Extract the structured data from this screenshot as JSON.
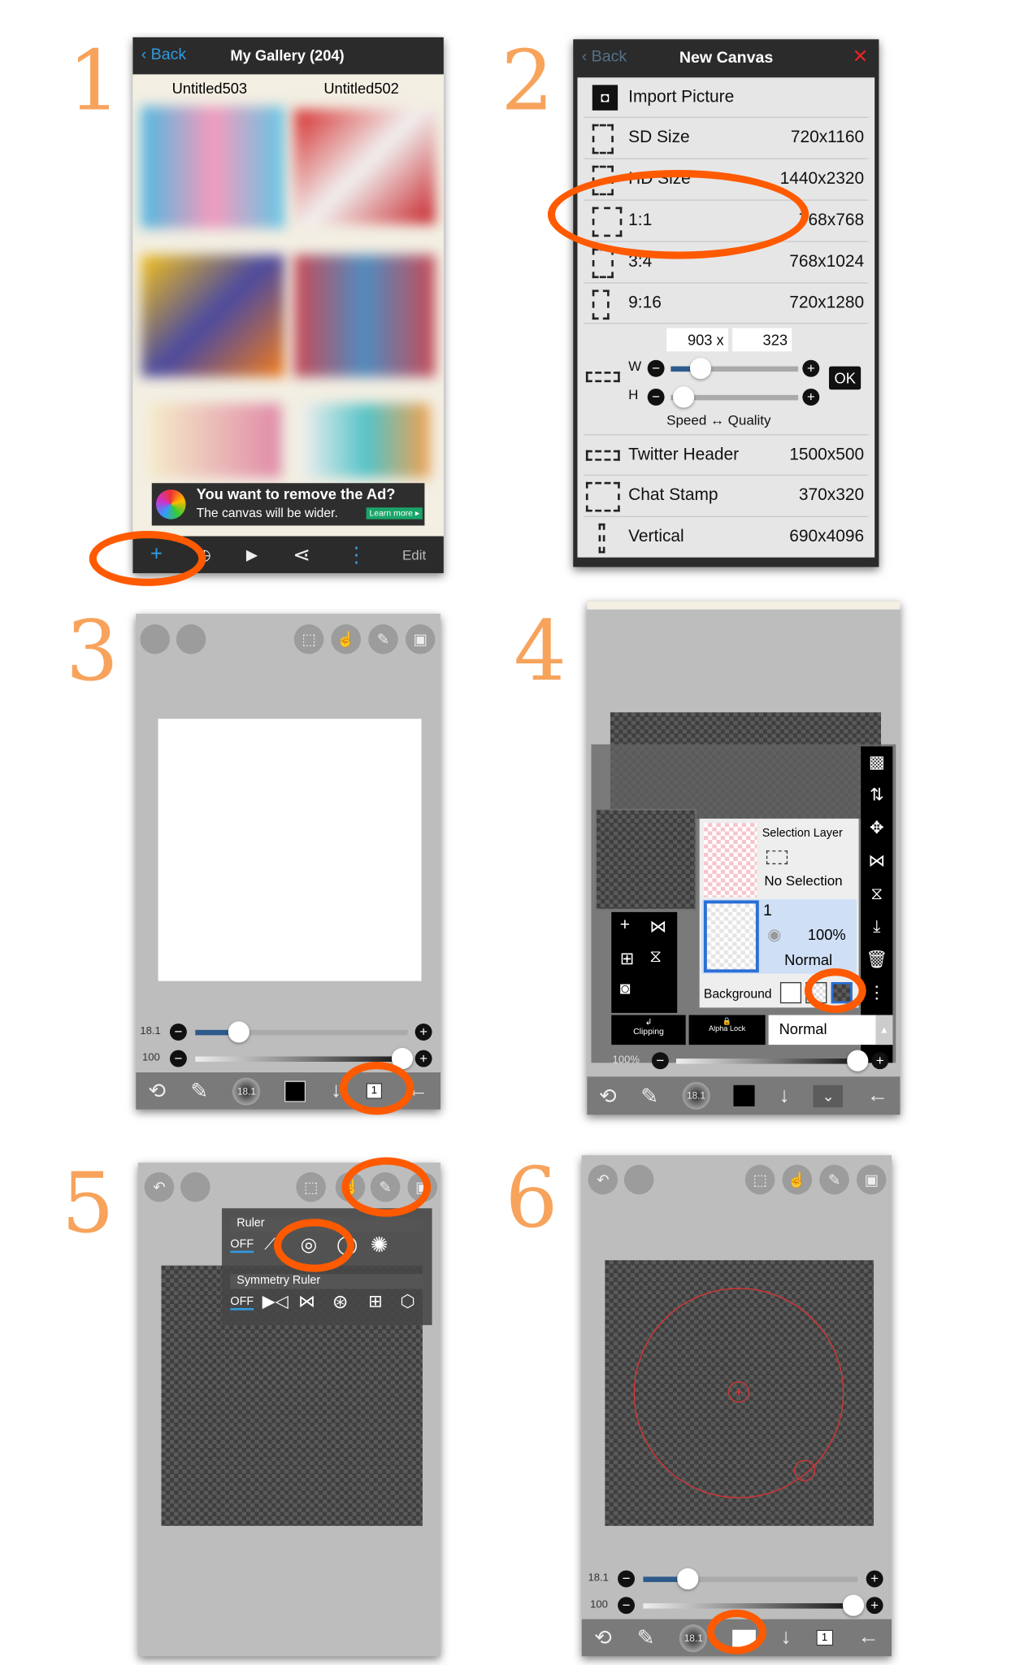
{
  "steps": [
    "1",
    "2",
    "3",
    "4",
    "5",
    "6"
  ],
  "colors": {
    "accent": "#ff5a00",
    "step_number": "#f7a35c",
    "app_blue": "#2f9be0"
  },
  "gallery": {
    "back": "Back",
    "title": "My Gallery (204)",
    "items": [
      "Untitled503",
      "Untitled502"
    ],
    "ad": {
      "line1": "You want to remove the Ad?",
      "line2": "The canvas will be wider.",
      "cta": "Learn more ▸"
    },
    "toolbar": {
      "add": "+",
      "play": "▶",
      "share": "⋖",
      "more": "⋮",
      "edit": "Edit"
    }
  },
  "new_canvas": {
    "back": "Back",
    "title": "New Canvas",
    "close": "✕",
    "presets": [
      {
        "label": "Import Picture",
        "size": ""
      },
      {
        "label": "SD Size",
        "size": "720x1160"
      },
      {
        "label": "HD Size",
        "size": "1440x2320"
      },
      {
        "label": "1:1",
        "size": "768x768"
      },
      {
        "label": "3:4",
        "size": "768x1024"
      },
      {
        "label": "9:16",
        "size": "720x1280"
      }
    ],
    "custom": {
      "width": "903",
      "x": "x",
      "height": "323",
      "w_label": "W",
      "h_label": "H",
      "ok": "OK",
      "hint": "Speed ↔ Quality"
    },
    "more": [
      {
        "label": "Twitter Header",
        "size": "1500x500"
      },
      {
        "label": "Chat Stamp",
        "size": "370x320"
      },
      {
        "label": "Vertical",
        "size": "690x4096"
      }
    ]
  },
  "editor": {
    "brush_size": "18.1",
    "opacity": "100",
    "layer_count": "1",
    "brush_fill": 0.2,
    "opacity_fill": 1.0
  },
  "layers": {
    "selection_layer": "Selection Layer",
    "no_selection": "No Selection",
    "layer_name": "1",
    "layer_opacity": "100%",
    "layer_blend": "Normal",
    "background": "Background",
    "clipping": "Clipping",
    "alpha_lock": "Alpha Lock",
    "blend_mode": "Normal",
    "opacity": "100%"
  },
  "ruler_menu": {
    "ruler": "Ruler",
    "off": "OFF",
    "symmetry": "Symmetry Ruler",
    "sym_off": "OFF"
  }
}
